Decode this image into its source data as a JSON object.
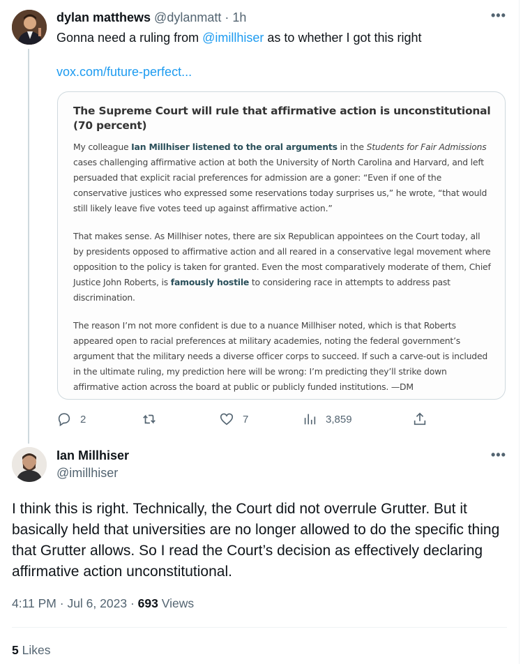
{
  "tweet1": {
    "name": "dylan matthews",
    "handle": "@dylanmatt",
    "time": "1h",
    "text_before": "Gonna need a ruling from ",
    "mention": "@imillhiser",
    "text_after": " as to whether I got this right",
    "link": "vox.com/future-perfect...",
    "media": {
      "title": "The Supreme Court will rule that affirmative action is unconstitutional (70 percent)",
      "p1_a": "My colleague ",
      "p1_link": "Ian Millhiser listened to the oral arguments",
      "p1_b": " in the ",
      "p1_italic": "Students for Fair Admissions",
      "p1_c": " cases challenging affirmative action at both the University of North Carolina and Harvard, and left persuaded that explicit racial preferences for admission are a goner: “Even if one of the conservative justices who expressed some reservations today surprises us,” he wrote, “that would still likely leave five votes teed up against affirmative action.”",
      "p2_a": "That makes sense. As Millhiser notes, there are six Republican appointees on the Court today, all by presidents opposed to affirmative action and all reared in a conservative legal movement where opposition to the policy is taken for granted. Even the most comparatively moderate of them, Chief Justice John Roberts, is ",
      "p2_link": "famously hostile",
      "p2_b": " to considering race in attempts to address past discrimination.",
      "p3": "The reason I’m not more confident is due to a nuance Millhiser noted, which is that Roberts appeared open to racial preferences at military academies, noting the federal government’s argument that the military needs a diverse officer corps to succeed. If such a carve-out is included in the ultimate ruling, my prediction here will be wrong: I’m predicting they’ll strike down affirmative action across the board at public or publicly funded institutions. —DM"
    },
    "actions": {
      "replies": "2",
      "retweets": "",
      "likes": "7",
      "views": "3,859"
    }
  },
  "tweet2": {
    "name": "Ian Millhiser",
    "handle": "@imillhiser",
    "body": "I think this is right. Technically, the Court did not overrule Grutter. But it basically held that universities are no longer allowed to do the specific thing that Grutter allows. So I read the Court’s decision as effectively declaring affirmative action unconstitutional.",
    "time": "4:11 PM",
    "date": "Jul 6, 2023",
    "views_count": "693",
    "views_label": "Views",
    "likes_count": "5",
    "likes_label": "Likes"
  },
  "ui": {
    "more_glyph": "•••",
    "dot": "·",
    "icons": [
      "reply-icon",
      "retweet-icon",
      "like-icon",
      "views-icon",
      "share-icon",
      "more-icon"
    ],
    "accent_color": "#1d9bf0"
  }
}
